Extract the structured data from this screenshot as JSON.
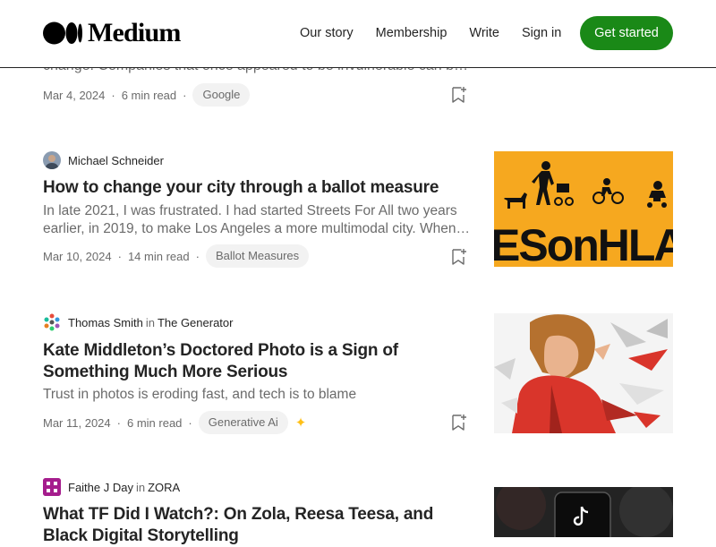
{
  "header": {
    "logo_text": "Medium",
    "nav": [
      "Our story",
      "Membership",
      "Write",
      "Sign in"
    ],
    "cta": "Get started"
  },
  "colors": {
    "brand_green": "#1a8917",
    "text": "#242424",
    "muted": "#6b6b6b",
    "tag_bg": "#f2f2f2",
    "sparkle": "#ffc017"
  },
  "articles": [
    {
      "subtitle": "change. Companies that once appeared to be invulnerable can be…",
      "date": "Mar 4, 2024",
      "read_time": "6 min read",
      "tag": "Google",
      "bookmark_icon": "bookmark-add-icon"
    },
    {
      "author": "Michael Schneider",
      "title": "How to change your city through a ballot measure",
      "subtitle": "In late 2021, I was frustrated. I had started Streets For All two years earlier, in 2019, to make Los Angeles a more multimodal city. When…",
      "date": "Mar 10, 2024",
      "read_time": "14 min read",
      "tag": "Ballot Measures",
      "thumb_text": "ESonHLA"
    },
    {
      "author": "Thomas Smith",
      "in_word": "in",
      "publication": "The Generator",
      "title": "Kate Middleton’s Doctored Photo is a Sign of Something Much More Serious",
      "subtitle": "Trust in photos is eroding fast, and tech is to blame",
      "date": "Mar 11, 2024",
      "read_time": "6 min read",
      "tag": "Generative Ai",
      "member_icon": "sparkle-icon"
    },
    {
      "author": "Faithe J Day",
      "in_word": "in",
      "publication": "ZORA",
      "title": "What TF Did I Watch?: On Zola, Reesa Teesa, and Black Digital Storytelling"
    }
  ]
}
